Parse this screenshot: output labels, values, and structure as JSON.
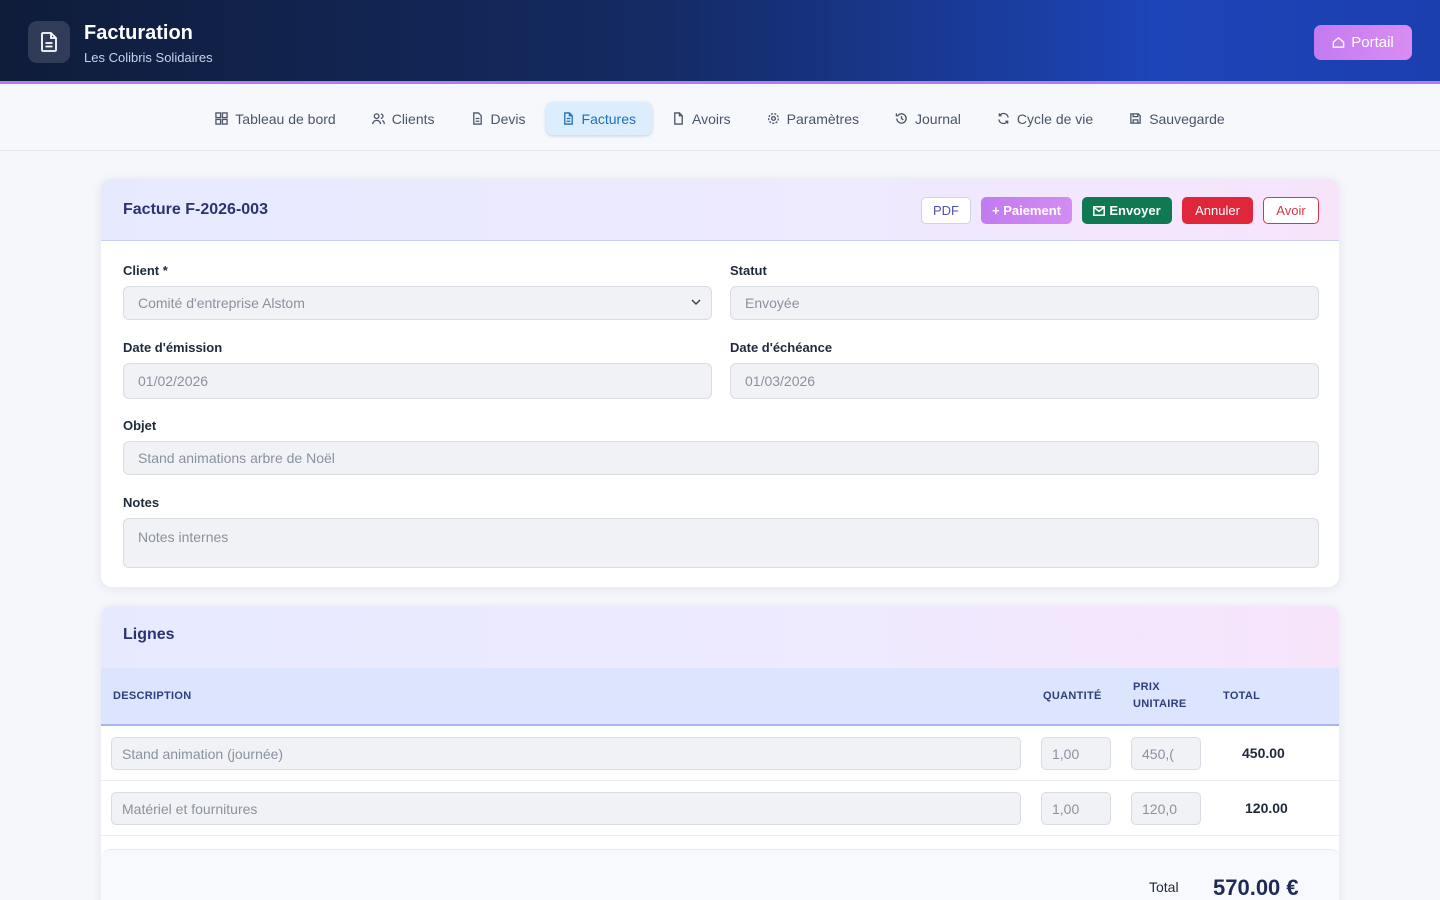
{
  "header": {
    "title": "Facturation",
    "subtitle": "Les Colibris Solidaires",
    "portal_label": "Portail"
  },
  "nav": {
    "items": [
      {
        "label": "Tableau de bord",
        "icon": "grid-icon"
      },
      {
        "label": "Clients",
        "icon": "users-icon"
      },
      {
        "label": "Devis",
        "icon": "document-icon"
      },
      {
        "label": "Factures",
        "icon": "invoice-icon",
        "active": true
      },
      {
        "label": "Avoirs",
        "icon": "document-icon"
      },
      {
        "label": "Paramètres",
        "icon": "gear-icon"
      },
      {
        "label": "Journal",
        "icon": "history-icon"
      },
      {
        "label": "Cycle de vie",
        "icon": "refresh-icon"
      },
      {
        "label": "Sauvegarde",
        "icon": "save-icon"
      }
    ]
  },
  "invoice": {
    "title": "Facture F-2026-003",
    "actions": {
      "pdf": "PDF",
      "payment": "+ Paiement",
      "send": "Envoyer",
      "cancel": "Annuler",
      "credit": "Avoir"
    },
    "client_label": "Client *",
    "client_value": "Comité d'entreprise Alstom",
    "status_label": "Statut",
    "status_value": "Envoyée",
    "issue_label": "Date d'émission",
    "issue_value": "01/02/2026",
    "due_label": "Date d'échéance",
    "due_value": "01/03/2026",
    "object_label": "Objet",
    "object_value": "Stand animations arbre de Noël",
    "notes_label": "Notes",
    "notes_placeholder": "Notes internes"
  },
  "lines": {
    "title": "Lignes",
    "columns": {
      "description": "DESCRIPTION",
      "quantity": "QUANTITÉ",
      "unit_price_1": "PRIX",
      "unit_price_2": "UNITAIRE",
      "total": "TOTAL"
    },
    "rows": [
      {
        "description": "Stand animation (journée)",
        "quantity": "1,00",
        "unit_price": "450,(",
        "total": "450.00"
      },
      {
        "description": "Matériel et fournitures",
        "quantity": "1,00",
        "unit_price": "120,0",
        "total": "120.00"
      }
    ],
    "total_label": "Total",
    "total_value": "570.00 €"
  },
  "colors": {
    "accent": "#1f6fb6",
    "payment": "#c27bf0",
    "send": "#0f7a52",
    "cancel": "#e0263a"
  }
}
